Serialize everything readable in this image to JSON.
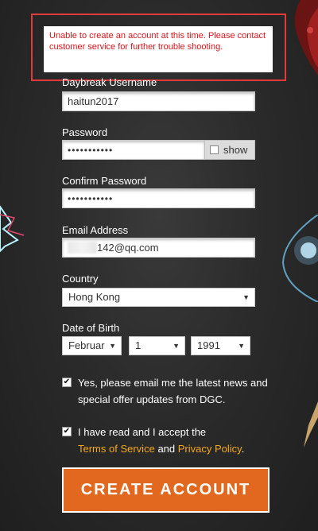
{
  "error": {
    "message": "Unable to create an account at this time. Please contact customer service for further trouble shooting."
  },
  "form": {
    "username": {
      "label": "Daybreak Username",
      "value": "haitun2017"
    },
    "password": {
      "label": "Password",
      "value": "•••••••••••",
      "show_label": "show"
    },
    "confirm_password": {
      "label": "Confirm Password",
      "value": "•••••••••••"
    },
    "email": {
      "label": "Email Address",
      "value": "142@qq.com"
    },
    "country": {
      "label": "Country",
      "value": "Hong Kong"
    },
    "dob": {
      "label": "Date of Birth",
      "month": "Februar",
      "day": "1",
      "year": "1991"
    },
    "newsletter": {
      "text": "Yes, please email me the latest news and special offer updates from DGC.",
      "checked": true
    },
    "terms": {
      "prefix": "I have read and I accept the",
      "terms_link": "Terms of Service",
      "and": "and",
      "privacy_link": "Privacy Policy",
      "suffix": ".",
      "checked": true
    },
    "submit_label": "CREATE ACCOUNT"
  },
  "colors": {
    "accent": "#e3681f",
    "link": "#f5a81c",
    "error_text": "#d9141a",
    "error_border": "#e03a3a"
  },
  "icons": {
    "checkbox_checked": "checkmark-icon",
    "dropdown": "chevron-down-icon"
  }
}
